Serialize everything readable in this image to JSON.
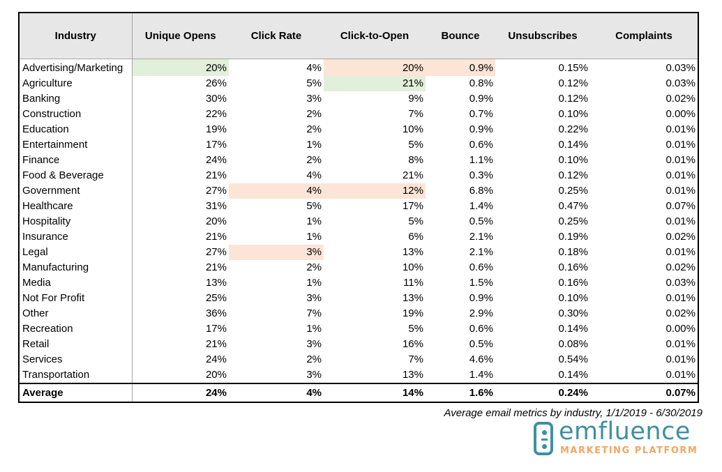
{
  "table": {
    "headers": [
      "Industry",
      "Unique Opens",
      "Click Rate",
      "Click-to-Open",
      "Bounce",
      "Unsubscribes",
      "Complaints"
    ],
    "rows": [
      {
        "industry": "Advertising/Marketing",
        "unique_opens": "20%",
        "click_rate": "4%",
        "click_to_open": "20%",
        "bounce": "0.9%",
        "unsubscribes": "0.15%",
        "complaints": "0.03%",
        "highlights": {
          "unique_opens": "green",
          "click_to_open": "red",
          "bounce": "red"
        }
      },
      {
        "industry": "Agriculture",
        "unique_opens": "26%",
        "click_rate": "5%",
        "click_to_open": "21%",
        "bounce": "0.8%",
        "unsubscribes": "0.12%",
        "complaints": "0.03%",
        "highlights": {
          "click_to_open": "green"
        }
      },
      {
        "industry": "Banking",
        "unique_opens": "30%",
        "click_rate": "3%",
        "click_to_open": "9%",
        "bounce": "0.9%",
        "unsubscribes": "0.12%",
        "complaints": "0.02%"
      },
      {
        "industry": "Construction",
        "unique_opens": "22%",
        "click_rate": "2%",
        "click_to_open": "7%",
        "bounce": "0.7%",
        "unsubscribes": "0.10%",
        "complaints": "0.00%"
      },
      {
        "industry": "Education",
        "unique_opens": "19%",
        "click_rate": "2%",
        "click_to_open": "10%",
        "bounce": "0.9%",
        "unsubscribes": "0.22%",
        "complaints": "0.01%"
      },
      {
        "industry": "Entertainment",
        "unique_opens": "17%",
        "click_rate": "1%",
        "click_to_open": "5%",
        "bounce": "0.6%",
        "unsubscribes": "0.14%",
        "complaints": "0.01%"
      },
      {
        "industry": "Finance",
        "unique_opens": "24%",
        "click_rate": "2%",
        "click_to_open": "8%",
        "bounce": "1.1%",
        "unsubscribes": "0.10%",
        "complaints": "0.01%"
      },
      {
        "industry": "Food & Beverage",
        "unique_opens": "21%",
        "click_rate": "4%",
        "click_to_open": "21%",
        "bounce": "0.3%",
        "unsubscribes": "0.12%",
        "complaints": "0.01%"
      },
      {
        "industry": "Government",
        "unique_opens": "27%",
        "click_rate": "4%",
        "click_to_open": "12%",
        "bounce": "6.8%",
        "unsubscribes": "0.25%",
        "complaints": "0.01%",
        "highlights": {
          "click_rate": "red",
          "click_to_open": "red"
        }
      },
      {
        "industry": "Healthcare",
        "unique_opens": "31%",
        "click_rate": "5%",
        "click_to_open": "17%",
        "bounce": "1.4%",
        "unsubscribes": "0.47%",
        "complaints": "0.07%"
      },
      {
        "industry": "Hospitality",
        "unique_opens": "20%",
        "click_rate": "1%",
        "click_to_open": "5%",
        "bounce": "0.5%",
        "unsubscribes": "0.25%",
        "complaints": "0.01%"
      },
      {
        "industry": "Insurance",
        "unique_opens": "21%",
        "click_rate": "1%",
        "click_to_open": "6%",
        "bounce": "2.1%",
        "unsubscribes": "0.19%",
        "complaints": "0.02%"
      },
      {
        "industry": "Legal",
        "unique_opens": "27%",
        "click_rate": "3%",
        "click_to_open": "13%",
        "bounce": "2.1%",
        "unsubscribes": "0.18%",
        "complaints": "0.01%",
        "highlights": {
          "click_rate": "red"
        }
      },
      {
        "industry": "Manufacturing",
        "unique_opens": "21%",
        "click_rate": "2%",
        "click_to_open": "10%",
        "bounce": "0.6%",
        "unsubscribes": "0.16%",
        "complaints": "0.02%"
      },
      {
        "industry": "Media",
        "unique_opens": "13%",
        "click_rate": "1%",
        "click_to_open": "11%",
        "bounce": "1.5%",
        "unsubscribes": "0.16%",
        "complaints": "0.03%"
      },
      {
        "industry": "Not For Profit",
        "unique_opens": "25%",
        "click_rate": "3%",
        "click_to_open": "13%",
        "bounce": "0.9%",
        "unsubscribes": "0.10%",
        "complaints": "0.01%"
      },
      {
        "industry": "Other",
        "unique_opens": "36%",
        "click_rate": "7%",
        "click_to_open": "19%",
        "bounce": "2.9%",
        "unsubscribes": "0.30%",
        "complaints": "0.02%"
      },
      {
        "industry": "Recreation",
        "unique_opens": "17%",
        "click_rate": "1%",
        "click_to_open": "5%",
        "bounce": "0.6%",
        "unsubscribes": "0.14%",
        "complaints": "0.00%"
      },
      {
        "industry": "Retail",
        "unique_opens": "21%",
        "click_rate": "3%",
        "click_to_open": "16%",
        "bounce": "0.5%",
        "unsubscribes": "0.08%",
        "complaints": "0.01%"
      },
      {
        "industry": "Services",
        "unique_opens": "24%",
        "click_rate": "2%",
        "click_to_open": "7%",
        "bounce": "4.6%",
        "unsubscribes": "0.54%",
        "complaints": "0.01%"
      },
      {
        "industry": "Transportation",
        "unique_opens": "20%",
        "click_rate": "3%",
        "click_to_open": "13%",
        "bounce": "1.4%",
        "unsubscribes": "0.14%",
        "complaints": "0.01%"
      }
    ],
    "average": {
      "industry": "Average",
      "unique_opens": "24%",
      "click_rate": "4%",
      "click_to_open": "14%",
      "bounce": "1.6%",
      "unsubscribes": "0.24%",
      "complaints": "0.07%"
    }
  },
  "colors": {
    "highlight_green": "#e2efda",
    "highlight_red": "#fce4d6",
    "header_bg": "#e7e7e7",
    "brand_teal": "#3d8fa3",
    "brand_orange": "#f6a55e"
  },
  "caption": "Average email metrics by industry, 1/1/2019 - 6/30/2019",
  "logo": {
    "icon": "emfluence-mark-icon",
    "wordmark": "emfluence",
    "tagline": "MARKETING PLATFORM"
  }
}
